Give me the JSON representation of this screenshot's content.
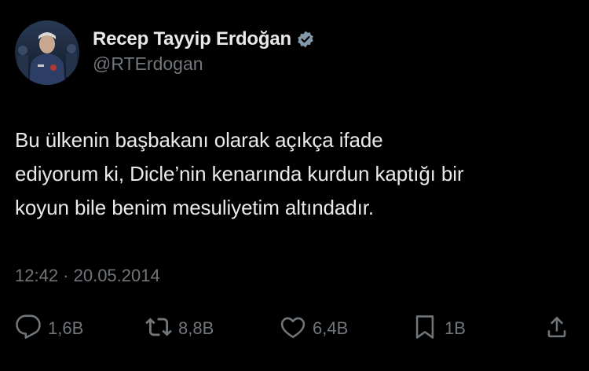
{
  "author": {
    "display_name": "Recep Tayyip Erdoğan",
    "handle": "@RTErdogan",
    "verified": true
  },
  "tweet": {
    "lines": [
      "Bu ülkenin başbakanı olarak açıkça ifade",
      "ediyorum ki, Dicle’nin kenarında kurdun kaptığı bir",
      "koyun bile benim mesuliyetim altındadır."
    ],
    "timestamp": "12:42 · 20.05.2014"
  },
  "actions": {
    "replies": "1,6B",
    "retweets": "8,8B",
    "likes": "6,4B",
    "bookmarks": "1B"
  },
  "colors": {
    "background": "#000000",
    "text": "#e7e9ea",
    "secondary": "#71767b",
    "verified_badge": "#829aab"
  },
  "icons": {
    "reply": "reply-icon",
    "retweet": "retweet-icon",
    "like": "heart-icon",
    "bookmark": "bookmark-icon",
    "share": "share-icon",
    "verified": "verified-badge-icon"
  }
}
